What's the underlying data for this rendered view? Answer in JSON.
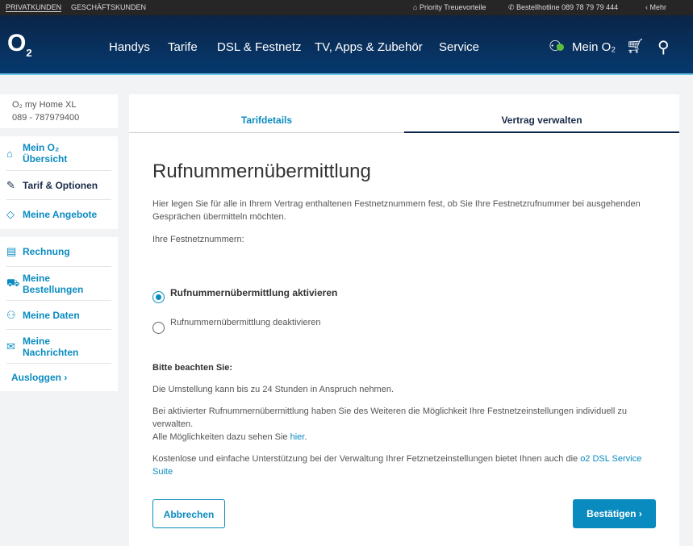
{
  "topbar": {
    "privat": "PRIVATKUNDEN",
    "geschaeft": "GESCHÄFTSKUNDEN",
    "priority": "Priority Treuevorteile",
    "hotline": "Bestellhotline 089 78 79 79 444",
    "mehr": "Mehr"
  },
  "header": {
    "logo": "O",
    "logo_sub": "2",
    "nav": [
      "Handys",
      "Tarife",
      "DSL & Festnetz",
      "TV, Apps & Zubehör",
      "Service"
    ],
    "mein": "Mein O₂"
  },
  "sidebar": {
    "product": "O₂ my Home XL",
    "number": "089 - 787979400",
    "group1": [
      {
        "icon": "home-icon",
        "label": "Mein O₂ Übersicht"
      },
      {
        "icon": "pencil-icon",
        "label": "Tarif & Optionen"
      },
      {
        "icon": "tag-icon",
        "label": "Meine Angebote"
      }
    ],
    "group2": [
      {
        "icon": "invoice-icon",
        "label": "Rechnung"
      },
      {
        "icon": "cart-icon",
        "label": "Meine Bestellungen"
      },
      {
        "icon": "user-icon",
        "label": "Meine Daten"
      },
      {
        "icon": "mail-icon",
        "label": "Meine Nachrichten"
      }
    ],
    "logout": "Ausloggen ›"
  },
  "tabs": [
    "Tarifdetails",
    "Vertrag verwalten"
  ],
  "main": {
    "title": "Rufnummernübermittlung",
    "intro": "Hier legen Sie für alle in Ihrem Vertrag enthaltenen Festnetznummern fest, ob Sie Ihre Festnetzrufnummer bei ausgehenden Gesprächen übermitteln möchten.",
    "numbers_label": "Ihre Festnetznummern:",
    "opt_on": "Rufnummernübermittlung aktivieren",
    "opt_off": "Rufnummernübermittlung deaktivieren",
    "note_title": "Bitte beachten Sie:",
    "note1": "Die Umstellung kann bis zu 24 Stunden in Anspruch nehmen.",
    "note2": "Bei aktivierter Rufnummernübermittlung haben Sie des Weiteren die Möglichkeit Ihre Festnetzeinstellungen individuell zu verwalten.",
    "note3_pre": "Alle Möglichkeiten dazu sehen Sie ",
    "note3_link": "hier",
    "note3_post": ".",
    "note4_pre": "Kostenlose und einfache Unterstützung bei der Verwaltung Ihrer Fetznetzeinstellungen bietet Ihnen auch die ",
    "note4_link": "o2 DSL Service Suite",
    "cancel": "Abbrechen",
    "confirm": "Bestätigen ›"
  }
}
